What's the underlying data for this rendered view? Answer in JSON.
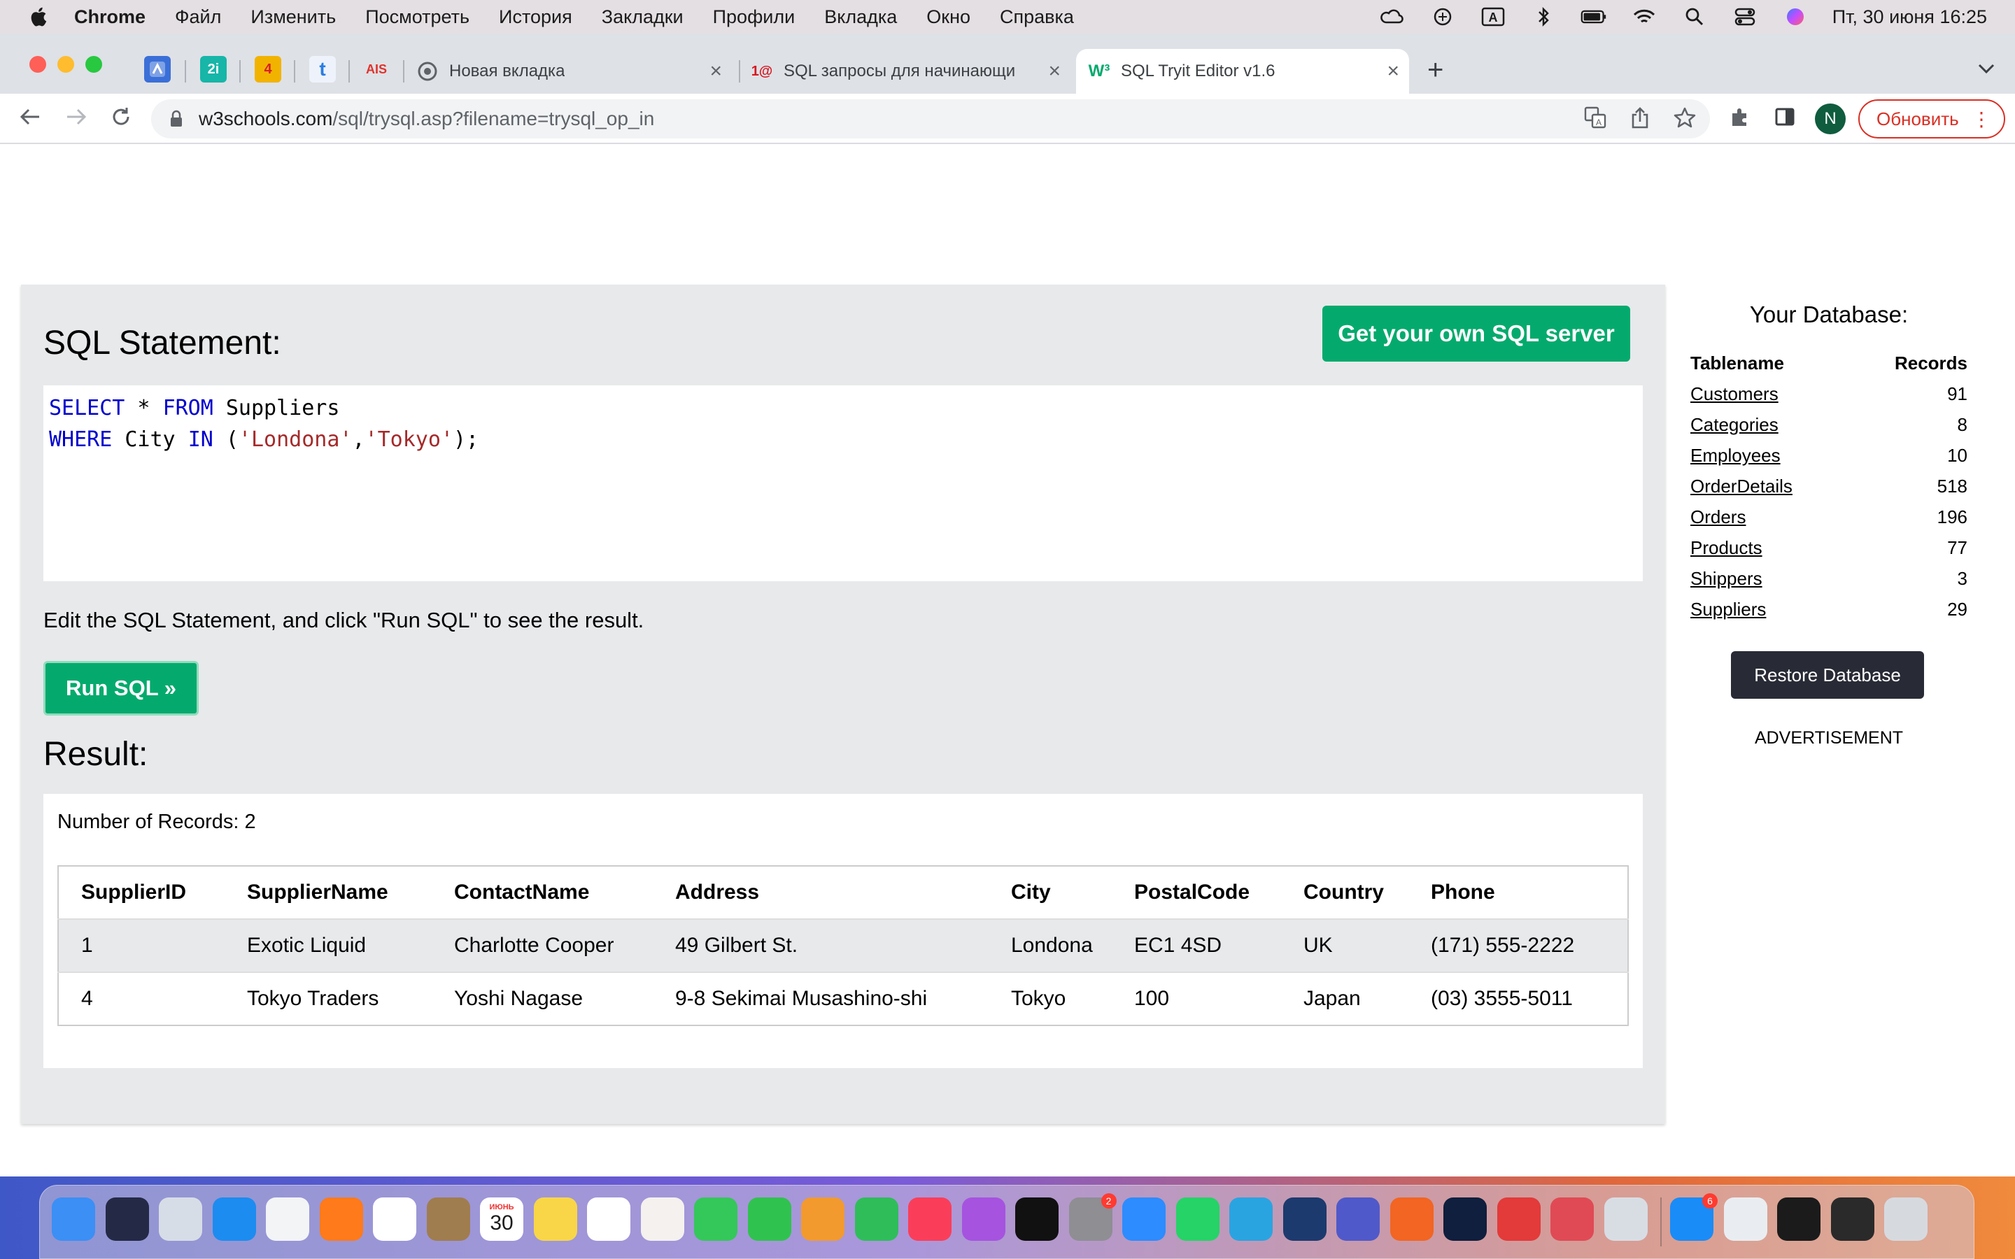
{
  "menubar": {
    "app": "Chrome",
    "items": [
      "Файл",
      "Изменить",
      "Посмотреть",
      "История",
      "Закладки",
      "Профили",
      "Вкладка",
      "Окно",
      "Справка"
    ],
    "clock": "Пт, 30 июня  16:25",
    "status_icons": [
      "creative-cloud-icon",
      "sync-icon",
      "keyboard-input-icon",
      "bluetooth-icon",
      "battery-icon",
      "wifi-icon",
      "search-icon",
      "control-center-icon",
      "siri-icon"
    ],
    "input_letter": "A"
  },
  "tabs": {
    "pinned": [
      {
        "icon": "app-icon-1"
      },
      {
        "icon": "app-icon-2",
        "text": "2i"
      },
      {
        "icon": "mail-icon",
        "text": "4"
      },
      {
        "icon": "t-icon",
        "text": "t"
      },
      {
        "icon": "ais-icon",
        "text": "AIS"
      }
    ],
    "items": [
      {
        "title": "Новая вкладка",
        "favicon": "chrome-icon"
      },
      {
        "title": "SQL запросы для начинающи",
        "favicon": "1c-icon",
        "favicon_text": "1@"
      },
      {
        "title": "SQL Tryit Editor v1.6",
        "favicon": "w3schools-icon",
        "favicon_text": "W³",
        "active": true
      }
    ]
  },
  "address": {
    "host": "w3schools.com",
    "path": "/sql/trysql.asp?filename=trysql_op_in"
  },
  "update_label": "Обновить",
  "profile_initial": "N",
  "editor": {
    "heading": "SQL Statement:",
    "own_server_label": "Get your own SQL server",
    "line1": {
      "kw1": "SELECT",
      "mid": " * ",
      "kw2": "FROM",
      "rest": " Suppliers"
    },
    "line2": {
      "kw1": "WHERE",
      "mid": " City ",
      "kw2": "IN",
      "open": " (",
      "s1": "'Londona'",
      "comma": ",",
      "s2": "'Tokyo'",
      "close": ");"
    },
    "hint": "Edit the SQL Statement, and click \"Run SQL\" to see the result.",
    "run_label": "Run SQL »"
  },
  "result": {
    "heading": "Result:",
    "count_text": "Number of Records: 2",
    "columns": [
      "SupplierID",
      "SupplierName",
      "ContactName",
      "Address",
      "City",
      "PostalCode",
      "Country",
      "Phone"
    ],
    "rows": [
      [
        "1",
        "Exotic Liquid",
        "Charlotte Cooper",
        "49 Gilbert St.",
        "Londona",
        "EC1 4SD",
        "UK",
        "(171) 555-2222"
      ],
      [
        "4",
        "Tokyo Traders",
        "Yoshi Nagase",
        "9-8 Sekimai Musashino-shi",
        "Tokyo",
        "100",
        "Japan",
        "(03) 3555-5011"
      ]
    ]
  },
  "database": {
    "title": "Your Database:",
    "col_name": "Tablename",
    "col_records": "Records",
    "tables": [
      {
        "name": "Customers",
        "records": "91"
      },
      {
        "name": "Categories",
        "records": "8"
      },
      {
        "name": "Employees",
        "records": "10"
      },
      {
        "name": "OrderDetails",
        "records": "518"
      },
      {
        "name": "Orders",
        "records": "196"
      },
      {
        "name": "Products",
        "records": "77"
      },
      {
        "name": "Shippers",
        "records": "3"
      },
      {
        "name": "Suppliers",
        "records": "29"
      }
    ],
    "restore_label": "Restore Database",
    "advert": "ADVERTISEMENT"
  },
  "dock": {
    "calendar_month": "ИЮНЬ",
    "calendar_day": "30",
    "badges": {
      "system_settings": "2",
      "app_store": "6"
    },
    "apps": [
      "finder-icon",
      "siri-icon",
      "launchpad-icon",
      "safari-icon",
      "chrome-icon",
      "firefox-icon",
      "yandex-icon",
      "contacts-icon",
      "calendar-icon",
      "notes-icon",
      "reminders-icon",
      "photos-icon",
      "messages-icon",
      "facetime-icon",
      "pages-icon",
      "numbers-icon",
      "music-icon",
      "podcasts-icon",
      "apple-tv-icon",
      "system-settings-icon",
      "zoom-icon",
      "whatsapp-icon",
      "telegram-icon",
      "cube-icon",
      "teams-icon",
      "pen-icon",
      "lightroom-icon",
      "creative-cloud-icon",
      "speech-icon",
      "preview-icon",
      "app-store-icon",
      "disk-utility-icon",
      "terminal-icon",
      "keyboard-icon",
      "trash-icon"
    ]
  }
}
